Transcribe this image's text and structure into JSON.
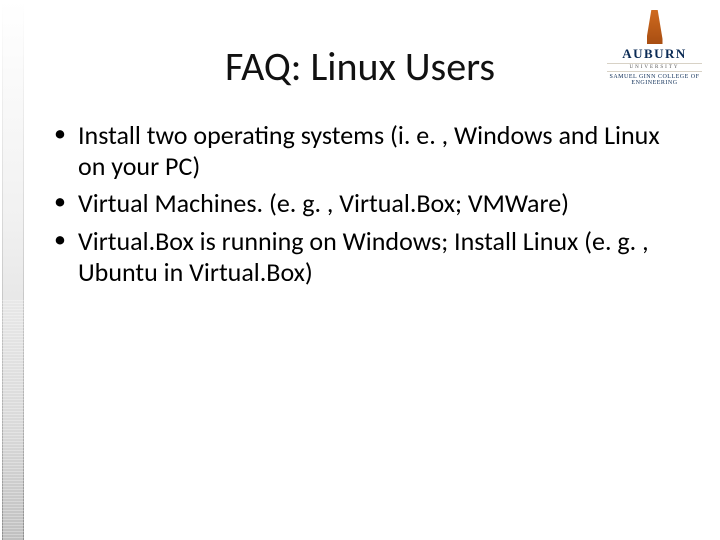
{
  "logo": {
    "word": "AUBURN",
    "sub1": "UNIVERSITY",
    "sub2": "SAMUEL GINN COLLEGE OF ENGINEERING"
  },
  "title": "FAQ: Linux Users",
  "bullets": [
    "Install two operating systems (i. e. , Windows and Linux on your PC)",
    "Virtual Machines. (e. g. , Virtual.Box; VMWare)",
    "Virtual.Box is running on Windows; Install Linux (e. g. , Ubuntu in Virtual.Box)"
  ]
}
